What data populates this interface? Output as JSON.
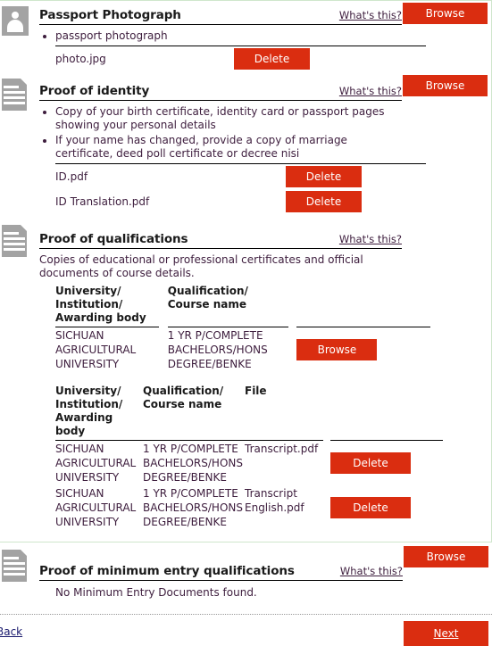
{
  "common": {
    "whats_this": "What's this?",
    "browse_label": "Browse",
    "delete_label": "Delete"
  },
  "colors": {
    "button_red": "#da2d10",
    "body_text": "#3d1d3d",
    "heading_text": "#1a1a1a",
    "icon_gray": "#a3a3a3",
    "region_border_green": "#cfe6cc",
    "back_link_blue": "#1a1a6e"
  },
  "sections": {
    "passport": {
      "icon": "person-icon",
      "title": "Passport Photograph",
      "whats_this": "What's this?",
      "browse_label": "Browse",
      "bullets": [
        "passport photograph"
      ],
      "files": [
        {
          "name": "photo.jpg",
          "action": "Delete"
        }
      ]
    },
    "identity": {
      "icon": "document-icon",
      "title": "Proof of identity",
      "whats_this": "What's this?",
      "browse_label": "Browse",
      "bullets": [
        "Copy of your birth certificate, identity card or passport pages showing your personal details",
        "If your name has changed, provide a copy of marriage certificate, deed poll certificate or decree nisi"
      ],
      "files": [
        {
          "name": "ID.pdf",
          "action": "Delete"
        },
        {
          "name": "ID Translation.pdf",
          "action": "Delete"
        }
      ]
    },
    "qualifications": {
      "icon": "document-icon",
      "title": "Proof of qualifications",
      "whats_this": "What's this?",
      "description": "Copies of educational or professional certificates and official documents of course details.",
      "upload_table": {
        "headers": [
          "University/ Institution/ Awarding body",
          "Qualification/ Course name",
          ""
        ],
        "rows": [
          {
            "university": "SICHUAN AGRICULTURAL UNIVERSITY",
            "qualification": "1 YR P/COMPLETE BACHELORS/HONS DEGREE/BENKE",
            "action": "Browse"
          }
        ]
      },
      "uploaded_table": {
        "headers": [
          "University/ Institution/ Awarding body",
          "Qualification/ Course name",
          "File",
          ""
        ],
        "rows": [
          {
            "university": "SICHUAN AGRICULTURAL UNIVERSITY",
            "qualification": "1 YR P/COMPLETE BACHELORS/HONS DEGREE/BENKE",
            "file": "Transcript.pdf",
            "action": "Delete"
          },
          {
            "university": "SICHUAN AGRICULTURAL UNIVERSITY",
            "qualification": "1 YR P/COMPLETE BACHELORS/HONS DEGREE/BENKE",
            "file": "Transcript English.pdf",
            "action": "Delete"
          }
        ]
      }
    },
    "minimum_entry": {
      "icon": "document-icon",
      "title": "Proof of minimum entry qualifications",
      "whats_this": "What's this?",
      "browse_label": "Browse",
      "empty_message": "No Minimum Entry Documents found."
    }
  },
  "nav": {
    "back_label": "Back",
    "next_label": "Next"
  }
}
